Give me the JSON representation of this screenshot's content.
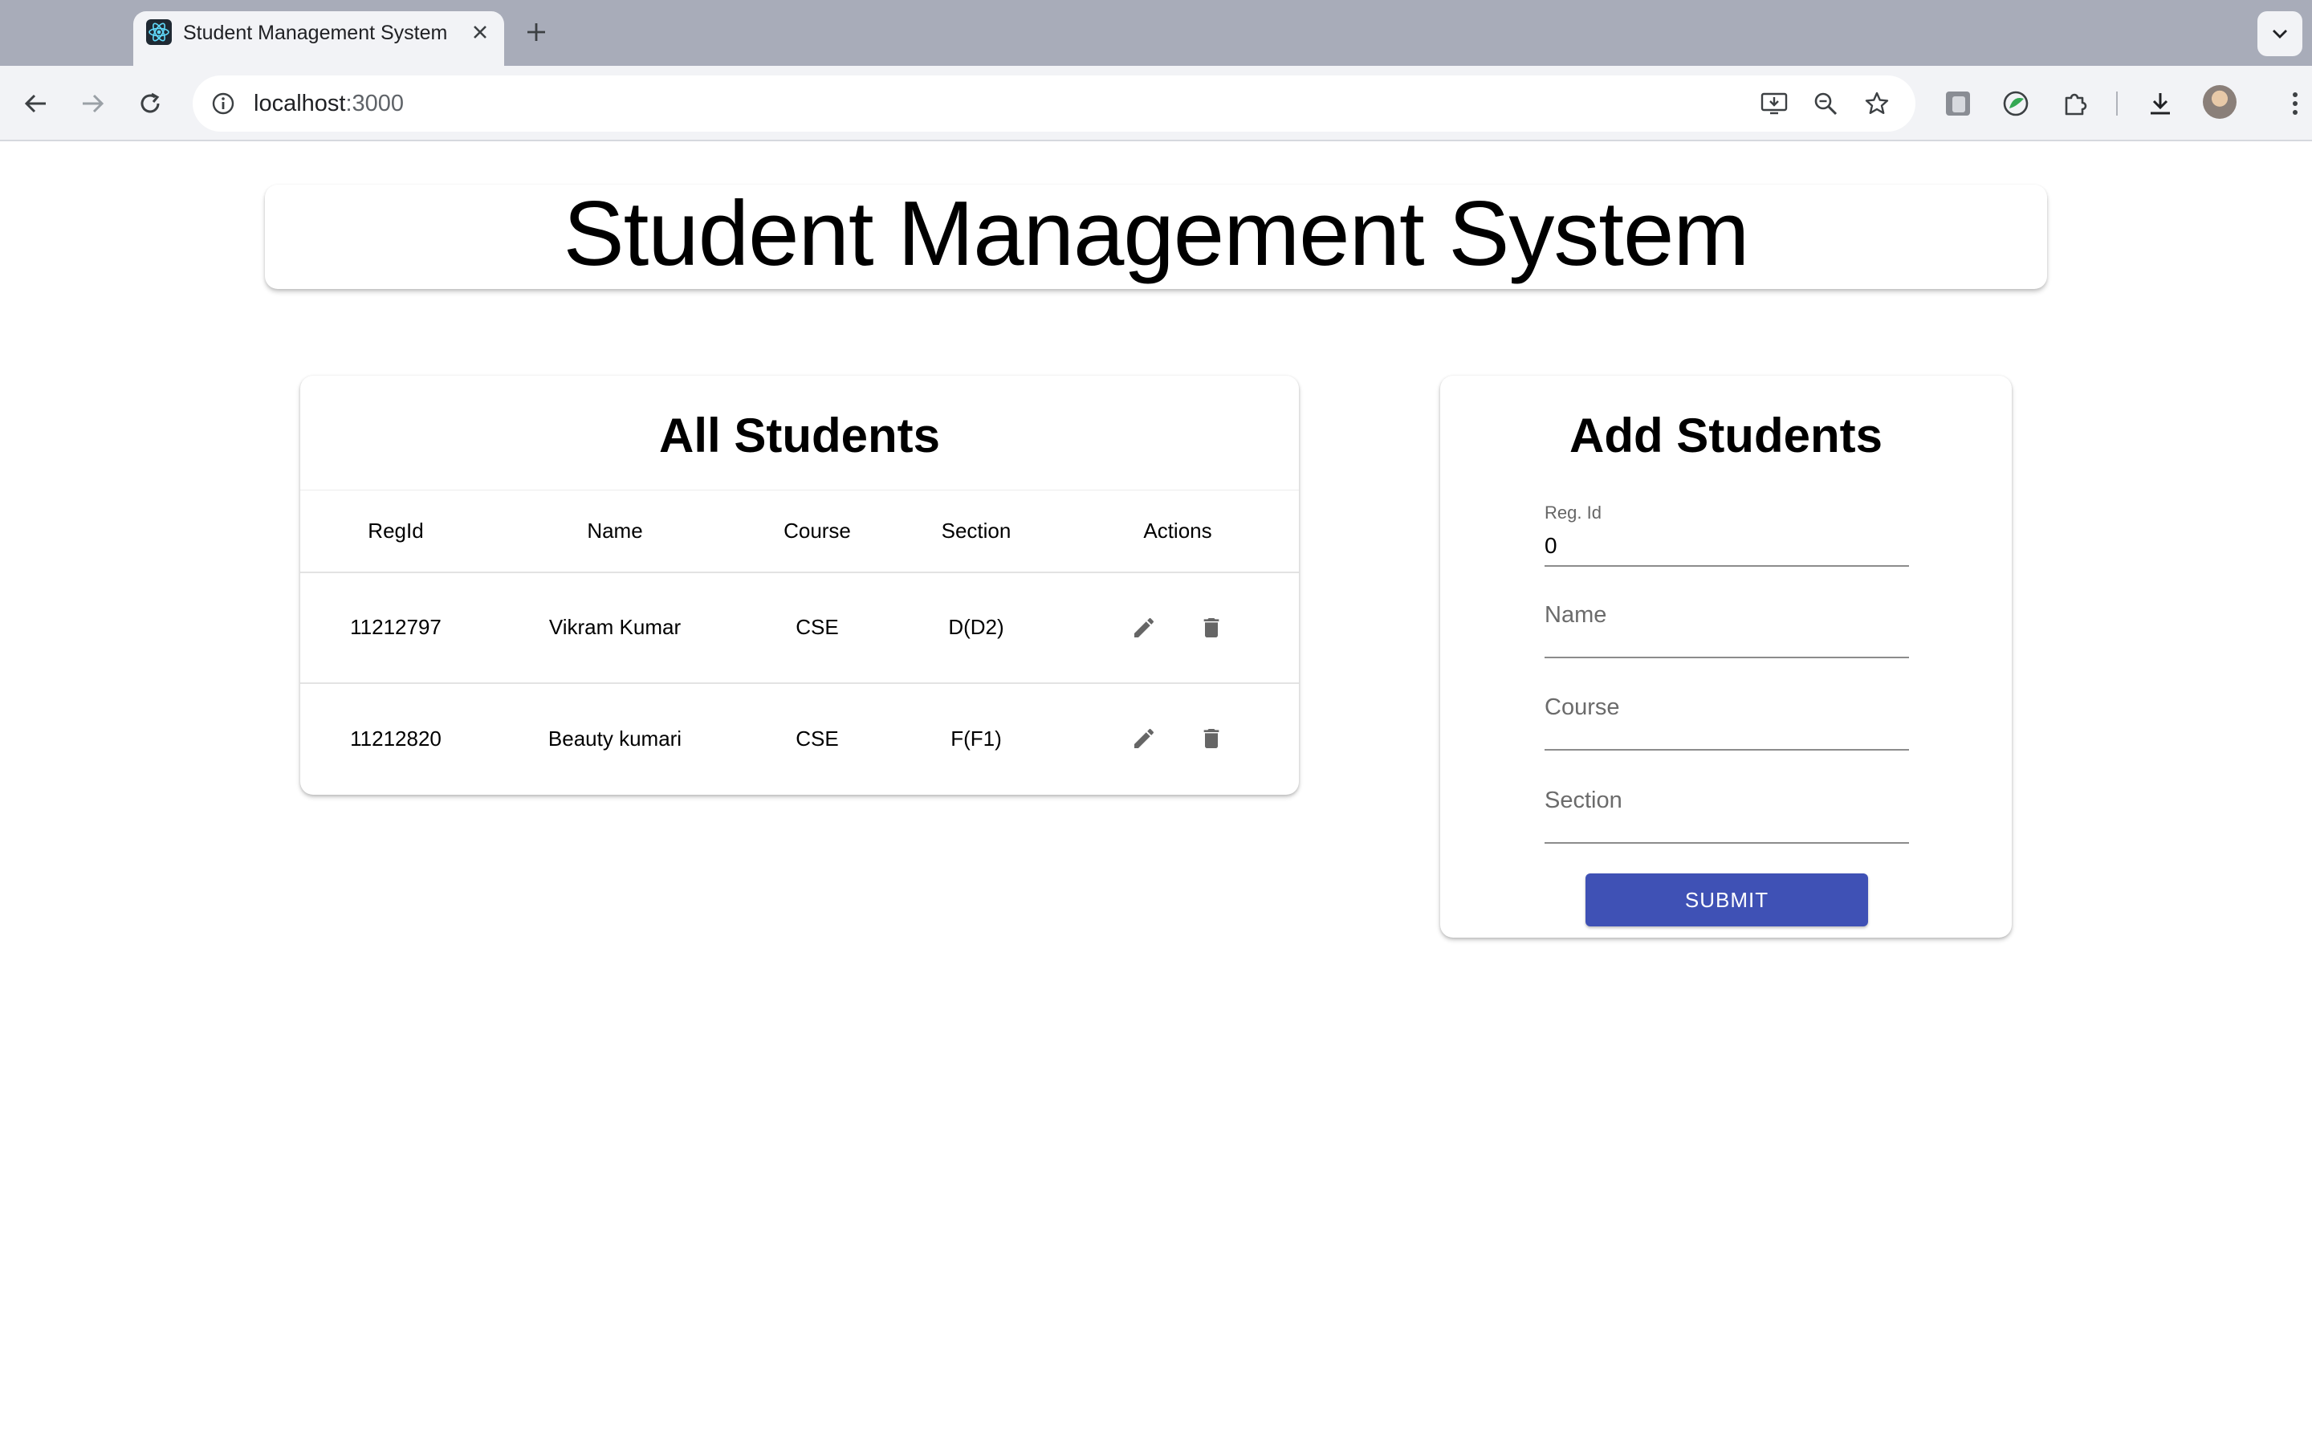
{
  "browser": {
    "tab_title": "Student Management System",
    "url_host": "localhost",
    "url_port": ":3000",
    "icons": [
      "react-icon",
      "close-icon",
      "plus-icon",
      "chevron-down-icon",
      "back-arrow-icon",
      "forward-arrow-icon",
      "reload-icon",
      "info-icon",
      "install-app-icon",
      "zoom-icon",
      "star-icon",
      "extension-1-icon",
      "extension-2-icon",
      "puzzle-icon",
      "download-icon",
      "profile-avatar",
      "kebab-menu-icon"
    ]
  },
  "app": {
    "title": "Student Management System",
    "students_heading": "All Students",
    "add_heading": "Add Students"
  },
  "table": {
    "columns": [
      "RegId",
      "Name",
      "Course",
      "Section",
      "Actions"
    ],
    "rows": [
      {
        "regid": "11212797",
        "name": "Vikram Kumar",
        "course": "CSE",
        "section": "D(D2)"
      },
      {
        "regid": "11212820",
        "name": "Beauty kumari",
        "course": "CSE",
        "section": "F(F1)"
      }
    ],
    "action_icons": [
      "edit-pencil-icon",
      "delete-trash-icon"
    ]
  },
  "form": {
    "reg_label": "Reg. Id",
    "reg_value": "0",
    "name_placeholder": "Name",
    "course_placeholder": "Course",
    "section_placeholder": "Section",
    "submit_label": "SUBMIT"
  },
  "colors": {
    "tabstrip": "#a8acb9",
    "toolbar": "#f2f3f6",
    "submit_bg": "#3f51b5",
    "icon_grey": "#666666"
  }
}
